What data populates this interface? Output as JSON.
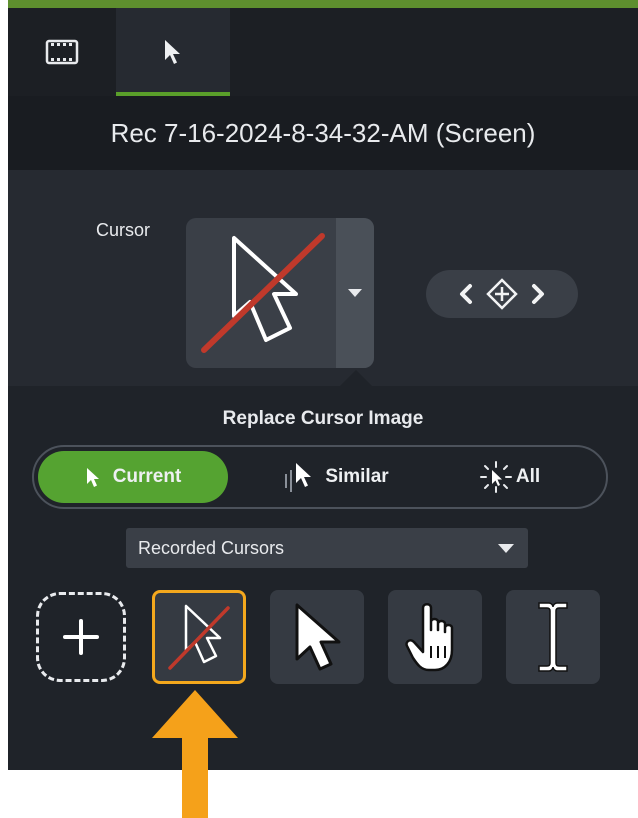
{
  "tabs": [
    {
      "icon": "film-strip-icon"
    },
    {
      "icon": "cursor-arrow-icon",
      "selected": true
    }
  ],
  "media_title": "Rec 7-16-2024-8-34-32-AM (Screen)",
  "cursor_property": {
    "label": "Cursor",
    "current_image": "hidden-cursor-icon"
  },
  "replace": {
    "title": "Replace Cursor Image",
    "options": [
      "Current",
      "Similar",
      "All"
    ],
    "selected": "Current"
  },
  "cursor_source": {
    "selected": "Recorded Cursors"
  },
  "cursor_tiles": [
    {
      "icon": "add-icon"
    },
    {
      "icon": "hidden-cursor-icon",
      "selected": true
    },
    {
      "icon": "arrow-cursor-icon"
    },
    {
      "icon": "hand-cursor-icon"
    },
    {
      "icon": "text-cursor-icon"
    }
  ],
  "colors": {
    "accent_green": "#55a331",
    "selection_orange": "#f4a81d",
    "annotation_arrow": "#f5a11a",
    "slash_red": "#c0392b"
  }
}
